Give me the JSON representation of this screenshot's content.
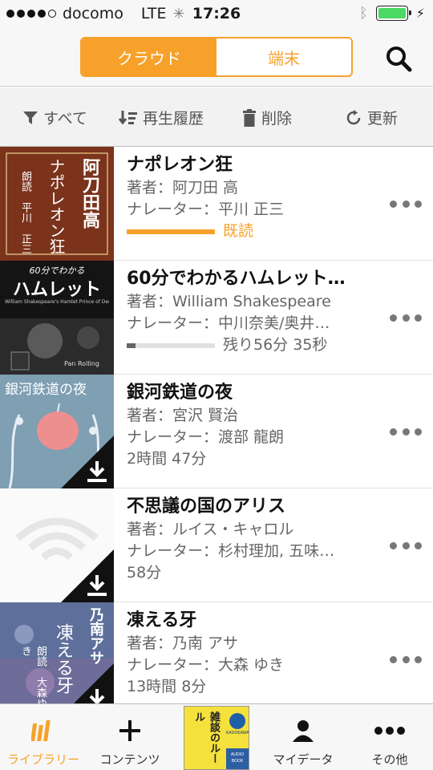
{
  "status_bar": {
    "carrier": "docomo",
    "network": "LTE",
    "time": "17:26",
    "battery_level": 1.0
  },
  "nav": {
    "segments": [
      {
        "label": "クラウド",
        "active": true
      },
      {
        "label": "端末",
        "active": false
      }
    ],
    "search_icon": "search-icon"
  },
  "toolbar": {
    "filter_label": "すべて",
    "sort_label": "再生履歴",
    "delete_label": "削除",
    "refresh_label": "更新"
  },
  "books": [
    {
      "title": "ナポレオン狂",
      "author": "著者：阿刀田 高",
      "narrator": "ナレーター：平川 正三",
      "status": "既読",
      "progress": 1.0,
      "downloaded": false,
      "cover_text": [
        "阿刀田高",
        "ナポレオン狂",
        "朗読　平川　正三"
      ]
    },
    {
      "title": "60分でわかるハムレット…",
      "author": "著者：William Shakespeare",
      "narrator": "ナレーター：中川奈美/奥井…",
      "status": "残り56分 35秒",
      "progress": 0.1,
      "downloaded": false,
      "cover_text": [
        "60分でわかる",
        "ハムレット",
        "William Shakespeare's Hamlet Prince of Denmark",
        "Pan Rolling"
      ]
    },
    {
      "title": "銀河鉄道の夜",
      "author": "著者：宮沢 賢治",
      "narrator": "ナレーター：渡部 龍朗",
      "status": "2時間 47分",
      "progress": null,
      "downloaded": true,
      "cover_text": [
        "銀河鉄道の夜"
      ]
    },
    {
      "title": "不思議の国のアリス",
      "author": "著者：ルイス・キャロル",
      "narrator": "ナレーター：杉村理加, 五味…",
      "status": "58分",
      "progress": null,
      "downloaded": true,
      "cover_text": []
    },
    {
      "title": "凍える牙",
      "author": "著者：乃南 アサ",
      "narrator": "ナレーター：大森 ゆき",
      "status": "13時間 8分",
      "progress": null,
      "downloaded": true,
      "cover_text": [
        "乃南アサ",
        "凍える牙",
        "朗読　大森ゆき"
      ]
    }
  ],
  "tab_bar": {
    "tabs": [
      {
        "label": "ライブラリー",
        "icon": "library-icon",
        "active": true
      },
      {
        "label": "コンテンツ",
        "icon": "plus-icon",
        "active": false
      },
      {
        "label": "",
        "icon": "promo-book-cover",
        "active": false
      },
      {
        "label": "マイデータ",
        "icon": "person-icon",
        "active": false
      },
      {
        "label": "その他",
        "icon": "more-icon",
        "active": false
      }
    ],
    "promo_text": [
      "雑談のルール",
      "AUDIO BOOK",
      "KADOKAWA"
    ]
  },
  "colors": {
    "accent": "#f7a12b",
    "progress_gray": "#666666"
  }
}
